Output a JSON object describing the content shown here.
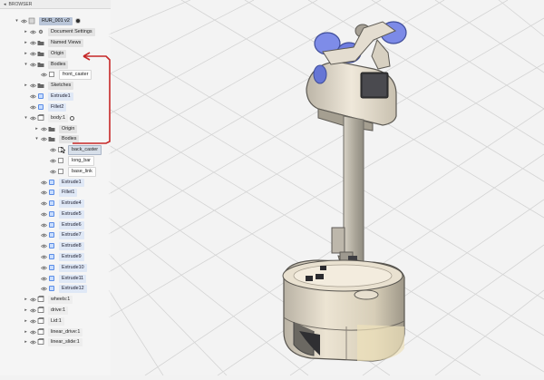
{
  "browser": {
    "title": "BROWSER",
    "accent": "#c62828",
    "items": [
      {
        "id": "root",
        "label": "RUR_001 v2",
        "level": 0,
        "expand": "down",
        "kind": "root"
      },
      {
        "id": "doc-settings",
        "label": "Document Settings",
        "level": 1,
        "expand": "right",
        "kind": "gear"
      },
      {
        "id": "named-views",
        "label": "Named Views",
        "level": 1,
        "expand": "right",
        "kind": "folder"
      },
      {
        "id": "origin",
        "label": "Origin",
        "level": 1,
        "expand": "right",
        "kind": "folder"
      },
      {
        "id": "bodies",
        "label": "Bodies",
        "level": 1,
        "expand": "down",
        "kind": "folder"
      },
      {
        "id": "front-caster",
        "label": "front_caster",
        "level": 2,
        "expand": "",
        "kind": "body"
      },
      {
        "id": "sketches",
        "label": "Sketches",
        "level": 1,
        "expand": "right",
        "kind": "folder"
      },
      {
        "id": "extrude1",
        "label": "Extrude1",
        "level": 1,
        "expand": "",
        "kind": "feature"
      },
      {
        "id": "fillet2",
        "label": "Fillet2",
        "level": 1,
        "expand": "",
        "kind": "feature"
      },
      {
        "id": "body1",
        "label": "body:1",
        "level": 1,
        "expand": "down",
        "kind": "component"
      },
      {
        "id": "origin2",
        "label": "Origin",
        "level": 2,
        "expand": "right",
        "kind": "folder"
      },
      {
        "id": "bodies2",
        "label": "Bodies",
        "level": 2,
        "expand": "down",
        "kind": "folder"
      },
      {
        "id": "back-caster",
        "label": "back_caster",
        "level": 3,
        "expand": "",
        "kind": "body"
      },
      {
        "id": "long-bar",
        "label": "long_bar",
        "level": 3,
        "expand": "",
        "kind": "body"
      },
      {
        "id": "base-link",
        "label": "base_link",
        "level": 3,
        "expand": "",
        "kind": "body"
      },
      {
        "id": "extrude1b",
        "label": "Extrude1",
        "level": 2,
        "expand": "",
        "kind": "feature"
      },
      {
        "id": "fillet1",
        "label": "Fillet1",
        "level": 2,
        "expand": "",
        "kind": "feature"
      },
      {
        "id": "extrude4",
        "label": "Extrude4",
        "level": 2,
        "expand": "",
        "kind": "feature"
      },
      {
        "id": "extrude5",
        "label": "Extrude5",
        "level": 2,
        "expand": "",
        "kind": "feature"
      },
      {
        "id": "extrude6",
        "label": "Extrude6",
        "level": 2,
        "expand": "",
        "kind": "feature"
      },
      {
        "id": "extrude7",
        "label": "Extrude7",
        "level": 2,
        "expand": "",
        "kind": "feature"
      },
      {
        "id": "extrude8",
        "label": "Extrude8",
        "level": 2,
        "expand": "",
        "kind": "feature"
      },
      {
        "id": "extrude9",
        "label": "Extrude9",
        "level": 2,
        "expand": "",
        "kind": "feature"
      },
      {
        "id": "extrude10",
        "label": "Extrude10",
        "level": 2,
        "expand": "",
        "kind": "feature"
      },
      {
        "id": "extrude11",
        "label": "Extrude11",
        "level": 2,
        "expand": "",
        "kind": "feature"
      },
      {
        "id": "extrude12",
        "label": "Extrude12",
        "level": 2,
        "expand": "",
        "kind": "feature"
      },
      {
        "id": "wheels1",
        "label": "wheels:1",
        "level": 1,
        "expand": "right",
        "kind": "component"
      },
      {
        "id": "drive1",
        "label": "drive:1",
        "level": 1,
        "expand": "right",
        "kind": "component"
      },
      {
        "id": "lid1",
        "label": "Lid:1",
        "level": 1,
        "expand": "right",
        "kind": "component"
      },
      {
        "id": "linear-drive1",
        "label": "linear_drive:1",
        "level": 1,
        "expand": "right",
        "kind": "component"
      },
      {
        "id": "linear-slide1",
        "label": "linear_slide:1",
        "level": 1,
        "expand": "right",
        "kind": "component"
      }
    ]
  }
}
